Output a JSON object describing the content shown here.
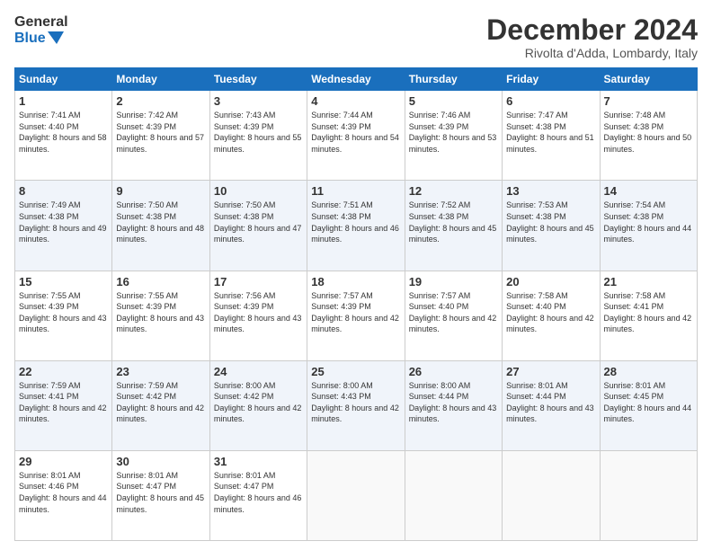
{
  "logo": {
    "line1": "General",
    "line2": "Blue"
  },
  "header": {
    "month": "December 2024",
    "location": "Rivolta d'Adda, Lombardy, Italy"
  },
  "weekdays": [
    "Sunday",
    "Monday",
    "Tuesday",
    "Wednesday",
    "Thursday",
    "Friday",
    "Saturday"
  ],
  "weeks": [
    [
      {
        "day": "1",
        "sunrise": "Sunrise: 7:41 AM",
        "sunset": "Sunset: 4:40 PM",
        "daylight": "Daylight: 8 hours and 58 minutes."
      },
      {
        "day": "2",
        "sunrise": "Sunrise: 7:42 AM",
        "sunset": "Sunset: 4:39 PM",
        "daylight": "Daylight: 8 hours and 57 minutes."
      },
      {
        "day": "3",
        "sunrise": "Sunrise: 7:43 AM",
        "sunset": "Sunset: 4:39 PM",
        "daylight": "Daylight: 8 hours and 55 minutes."
      },
      {
        "day": "4",
        "sunrise": "Sunrise: 7:44 AM",
        "sunset": "Sunset: 4:39 PM",
        "daylight": "Daylight: 8 hours and 54 minutes."
      },
      {
        "day": "5",
        "sunrise": "Sunrise: 7:46 AM",
        "sunset": "Sunset: 4:39 PM",
        "daylight": "Daylight: 8 hours and 53 minutes."
      },
      {
        "day": "6",
        "sunrise": "Sunrise: 7:47 AM",
        "sunset": "Sunset: 4:38 PM",
        "daylight": "Daylight: 8 hours and 51 minutes."
      },
      {
        "day": "7",
        "sunrise": "Sunrise: 7:48 AM",
        "sunset": "Sunset: 4:38 PM",
        "daylight": "Daylight: 8 hours and 50 minutes."
      }
    ],
    [
      {
        "day": "8",
        "sunrise": "Sunrise: 7:49 AM",
        "sunset": "Sunset: 4:38 PM",
        "daylight": "Daylight: 8 hours and 49 minutes."
      },
      {
        "day": "9",
        "sunrise": "Sunrise: 7:50 AM",
        "sunset": "Sunset: 4:38 PM",
        "daylight": "Daylight: 8 hours and 48 minutes."
      },
      {
        "day": "10",
        "sunrise": "Sunrise: 7:50 AM",
        "sunset": "Sunset: 4:38 PM",
        "daylight": "Daylight: 8 hours and 47 minutes."
      },
      {
        "day": "11",
        "sunrise": "Sunrise: 7:51 AM",
        "sunset": "Sunset: 4:38 PM",
        "daylight": "Daylight: 8 hours and 46 minutes."
      },
      {
        "day": "12",
        "sunrise": "Sunrise: 7:52 AM",
        "sunset": "Sunset: 4:38 PM",
        "daylight": "Daylight: 8 hours and 45 minutes."
      },
      {
        "day": "13",
        "sunrise": "Sunrise: 7:53 AM",
        "sunset": "Sunset: 4:38 PM",
        "daylight": "Daylight: 8 hours and 45 minutes."
      },
      {
        "day": "14",
        "sunrise": "Sunrise: 7:54 AM",
        "sunset": "Sunset: 4:38 PM",
        "daylight": "Daylight: 8 hours and 44 minutes."
      }
    ],
    [
      {
        "day": "15",
        "sunrise": "Sunrise: 7:55 AM",
        "sunset": "Sunset: 4:39 PM",
        "daylight": "Daylight: 8 hours and 43 minutes."
      },
      {
        "day": "16",
        "sunrise": "Sunrise: 7:55 AM",
        "sunset": "Sunset: 4:39 PM",
        "daylight": "Daylight: 8 hours and 43 minutes."
      },
      {
        "day": "17",
        "sunrise": "Sunrise: 7:56 AM",
        "sunset": "Sunset: 4:39 PM",
        "daylight": "Daylight: 8 hours and 43 minutes."
      },
      {
        "day": "18",
        "sunrise": "Sunrise: 7:57 AM",
        "sunset": "Sunset: 4:39 PM",
        "daylight": "Daylight: 8 hours and 42 minutes."
      },
      {
        "day": "19",
        "sunrise": "Sunrise: 7:57 AM",
        "sunset": "Sunset: 4:40 PM",
        "daylight": "Daylight: 8 hours and 42 minutes."
      },
      {
        "day": "20",
        "sunrise": "Sunrise: 7:58 AM",
        "sunset": "Sunset: 4:40 PM",
        "daylight": "Daylight: 8 hours and 42 minutes."
      },
      {
        "day": "21",
        "sunrise": "Sunrise: 7:58 AM",
        "sunset": "Sunset: 4:41 PM",
        "daylight": "Daylight: 8 hours and 42 minutes."
      }
    ],
    [
      {
        "day": "22",
        "sunrise": "Sunrise: 7:59 AM",
        "sunset": "Sunset: 4:41 PM",
        "daylight": "Daylight: 8 hours and 42 minutes."
      },
      {
        "day": "23",
        "sunrise": "Sunrise: 7:59 AM",
        "sunset": "Sunset: 4:42 PM",
        "daylight": "Daylight: 8 hours and 42 minutes."
      },
      {
        "day": "24",
        "sunrise": "Sunrise: 8:00 AM",
        "sunset": "Sunset: 4:42 PM",
        "daylight": "Daylight: 8 hours and 42 minutes."
      },
      {
        "day": "25",
        "sunrise": "Sunrise: 8:00 AM",
        "sunset": "Sunset: 4:43 PM",
        "daylight": "Daylight: 8 hours and 42 minutes."
      },
      {
        "day": "26",
        "sunrise": "Sunrise: 8:00 AM",
        "sunset": "Sunset: 4:44 PM",
        "daylight": "Daylight: 8 hours and 43 minutes."
      },
      {
        "day": "27",
        "sunrise": "Sunrise: 8:01 AM",
        "sunset": "Sunset: 4:44 PM",
        "daylight": "Daylight: 8 hours and 43 minutes."
      },
      {
        "day": "28",
        "sunrise": "Sunrise: 8:01 AM",
        "sunset": "Sunset: 4:45 PM",
        "daylight": "Daylight: 8 hours and 44 minutes."
      }
    ],
    [
      {
        "day": "29",
        "sunrise": "Sunrise: 8:01 AM",
        "sunset": "Sunset: 4:46 PM",
        "daylight": "Daylight: 8 hours and 44 minutes."
      },
      {
        "day": "30",
        "sunrise": "Sunrise: 8:01 AM",
        "sunset": "Sunset: 4:47 PM",
        "daylight": "Daylight: 8 hours and 45 minutes."
      },
      {
        "day": "31",
        "sunrise": "Sunrise: 8:01 AM",
        "sunset": "Sunset: 4:47 PM",
        "daylight": "Daylight: 8 hours and 46 minutes."
      },
      null,
      null,
      null,
      null
    ]
  ]
}
